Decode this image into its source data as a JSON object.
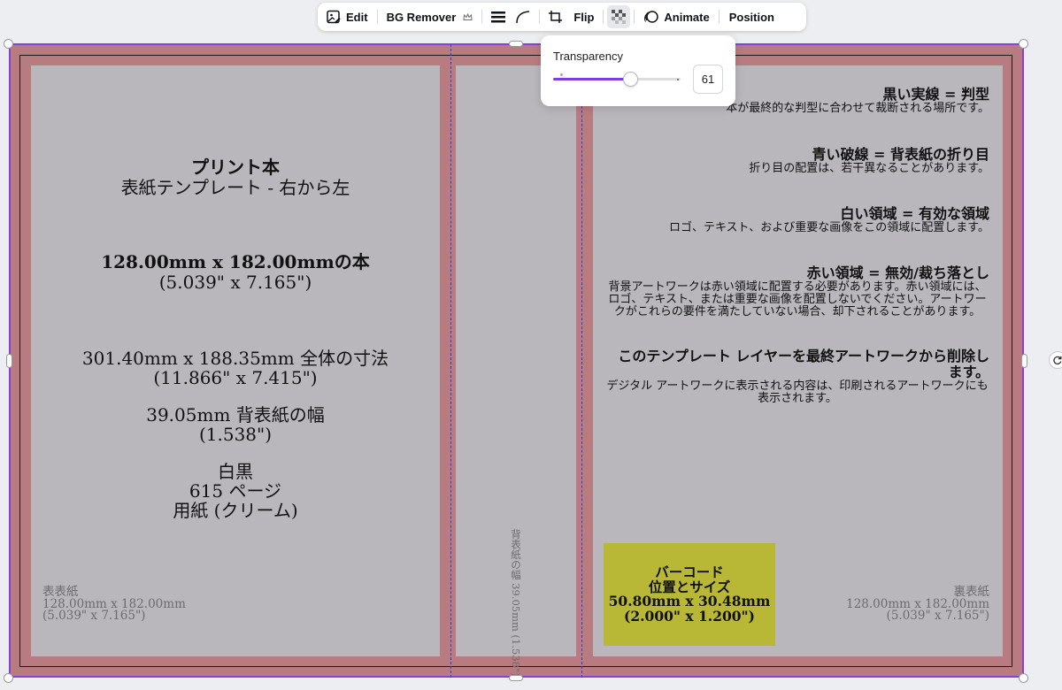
{
  "toolbar": {
    "edit_label": "Edit",
    "bg_remover_label": "BG Remover",
    "flip_label": "Flip",
    "animate_label": "Animate",
    "position_label": "Position",
    "icons": [
      "image-edit-icon",
      "crown-icon",
      "line-weight-icon",
      "corner-rounding-icon",
      "crop-icon",
      "transparency-checker-icon",
      "animate-icon"
    ]
  },
  "transparency": {
    "label": "Transparency",
    "value": "61",
    "fraction": 0.61,
    "accent_color": "#7b3fe4"
  },
  "front": {
    "title": "プリント本",
    "subtitle": "表紙テンプレート - 右から左",
    "book_size": "128.00mm x 182.00mmの本",
    "book_size_in": "(5.039\" x 7.165\")",
    "total_dims": "301.40mm x 188.35mm 全体の寸法",
    "total_dims_in": "(11.866\" x 7.415\")",
    "spine_width": "39.05mm 背表紙の幅",
    "spine_width_in": "(1.538\")",
    "color_mode": "白黒",
    "pages": "615 ページ",
    "paper": "用紙 (クリーム)",
    "corner_title": "表表紙",
    "corner_size": "128.00mm x 182.00mm",
    "corner_size_in": "(5.039\" x 7.165\")"
  },
  "spine": {
    "text": "背表紙の幅 39.05mm (1.538\")"
  },
  "back": {
    "rules": [
      {
        "title": "黒い実線 = 判型",
        "desc": "本が最終的な判型に合わせて裁断される場所です。"
      },
      {
        "title": "青い破線 = 背表紙の折り目",
        "desc": "折り目の配置は、若干異なることがあります。"
      },
      {
        "title": "白い領域 = 有効な領域",
        "desc": "ロゴ、テキスト、および重要な画像をこの領域に配置します。"
      },
      {
        "title": "赤い領域 = 無効/裁ち落とし",
        "desc": "背景アートワークは赤い領域に配置する必要があります。赤い領域には、ロゴ、テキスト、または重要な画像を配置しないでください。アートワークがこれらの要件を満たしていない場合、却下されることがあります。"
      },
      {
        "title": "このテンプレート レイヤーを最終アートワークから削除します。",
        "desc": "デジタル アートワークに表示される内容は、印刷されるアートワークにも表示されます。"
      }
    ],
    "barcode_line1": "バーコード",
    "barcode_line2": "位置とサイズ",
    "barcode_line3": "50.80mm x 30.48mm",
    "barcode_line4": "(2.000\" x 1.200\")",
    "corner_title": "裏表紙",
    "corner_size": "128.00mm x 182.00mm",
    "corner_size_in": "(5.039\" x 7.165\")"
  },
  "colors": {
    "bleed": "#b87c80",
    "safe_area": "#b9b7bc",
    "fold_line": "#2f3bdc",
    "barcode": "#b9b836",
    "selection": "#8b3fd9"
  }
}
